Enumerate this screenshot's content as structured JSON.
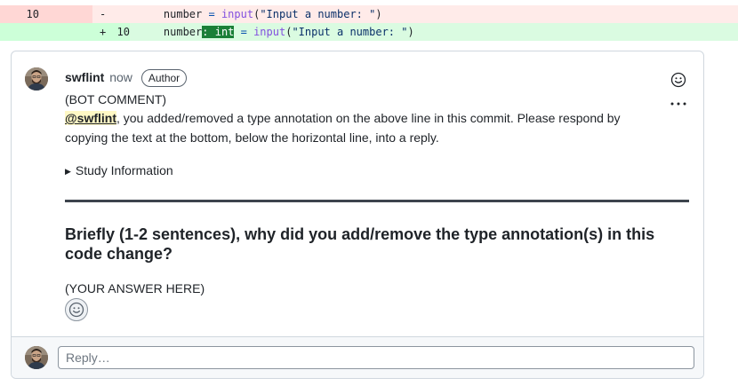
{
  "diff": {
    "deleted": {
      "old_line": "10",
      "new_line": "",
      "marker": "-",
      "indent": "    ",
      "var": "number",
      "eq": " = ",
      "fn": "input",
      "open": "(",
      "str": "\"Input a number: \"",
      "close": ")"
    },
    "added": {
      "old_line": "",
      "new_line": "10",
      "marker": "+",
      "indent": "    ",
      "var": "number",
      "annotation": ": int",
      "eq": " = ",
      "fn": "input",
      "open": "(",
      "str": "\"Input a number: \"",
      "close": ")"
    }
  },
  "comment": {
    "author": "swflint",
    "time": "now",
    "badge": "Author",
    "bot_label": "(BOT COMMENT)",
    "mention": "@swflint",
    "message": ", you added/removed a type annotation on the above line in this commit. Please respond by copying the text at the bottom, below the horizontal line, into a reply.",
    "details_summary": "Study Information",
    "question": "Briefly (1-2 sentences), why did you add/remove the type annotation(s) in this code change?",
    "answer": "(YOUR ANSWER HERE)"
  },
  "reply": {
    "placeholder": "Reply…"
  },
  "icons": {
    "emoji": "smiley-icon",
    "more": "kebab-horizontal-icon",
    "details_toggle": "triangle-right-icon"
  },
  "colors": {
    "deletion_bg": "#ffebe9",
    "addition_bg": "#dafbe1",
    "highlight": "#1a7f37",
    "mention_bg": "#fff8c5"
  }
}
